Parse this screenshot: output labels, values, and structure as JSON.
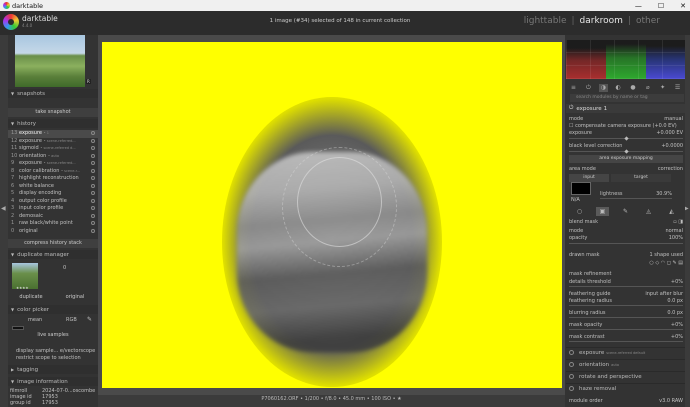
{
  "window": {
    "title": "darktable",
    "controls": [
      "—",
      "☐",
      "✕"
    ]
  },
  "brand": {
    "name": "darktable",
    "version": "4.4.0"
  },
  "header": {
    "collection_info": "1 image (#34) selected of 148 in current collection",
    "views": [
      {
        "label": "lighttable",
        "active": false
      },
      {
        "label": "darkroom",
        "active": true
      },
      {
        "label": "other",
        "active": false
      }
    ],
    "separator": "|"
  },
  "thumb_badge": "R",
  "left": {
    "snapshots": {
      "title": "snapshots",
      "take_snapshot": "take snapshot"
    },
    "history": {
      "title": "history",
      "items": [
        {
          "num": "13",
          "label": "exposure",
          "sub": "• 1"
        },
        {
          "num": "12",
          "label": "exposure",
          "sub": "• scene-referred..."
        },
        {
          "num": "11",
          "label": "sigmoid",
          "sub": "• scene-referred d..."
        },
        {
          "num": "10",
          "label": "orientation",
          "sub": "• auto"
        },
        {
          "num": "9",
          "label": "exposure",
          "sub": "• scene-referred..."
        },
        {
          "num": "8",
          "label": "color calibration",
          "sub": "• scene-r..."
        },
        {
          "num": "7",
          "label": "highlight reconstruction",
          "sub": ""
        },
        {
          "num": "6",
          "label": "white balance",
          "sub": ""
        },
        {
          "num": "5",
          "label": "display encoding",
          "sub": ""
        },
        {
          "num": "4",
          "label": "output color profile",
          "sub": ""
        },
        {
          "num": "3",
          "label": "input color profile",
          "sub": ""
        },
        {
          "num": "2",
          "label": "demosaic",
          "sub": ""
        },
        {
          "num": "1",
          "label": "raw black/white point",
          "sub": ""
        },
        {
          "num": "0",
          "label": "original",
          "sub": ""
        }
      ],
      "compress": "compress history stack"
    },
    "duplicate_manager": {
      "title": "duplicate manager",
      "version_number": "0",
      "stars": "★★★★",
      "duplicate": "duplicate",
      "original": "original"
    },
    "color_picker": {
      "title": "color picker",
      "mode": "mean",
      "space": "RGB",
      "live_samples": "live samples",
      "display_samples": "display sample... e/vectorscope",
      "restrict": "restrict scope to selection"
    },
    "tagging": {
      "title": "tagging"
    },
    "image_information": {
      "title": "image information",
      "rows": [
        {
          "key": "filmroll",
          "value": "2024-07-0...oscombe"
        },
        {
          "key": "image id",
          "value": "17953"
        },
        {
          "key": "group id",
          "value": "17953"
        }
      ]
    }
  },
  "center": {
    "info": "P7060162.ORF • 1/200 • f/8.0 • 45.0 mm • 100 ISO • ★"
  },
  "right": {
    "search_placeholder": "search modules by name or tag",
    "exposure_module": {
      "title": "exposure",
      "instance": "1",
      "mode_label": "mode",
      "mode_value": "manual",
      "compensate": "compensate camera exposure (+0.0 EV)",
      "exposure_label": "exposure",
      "exposure_value": "+0.000 EV",
      "exposure_fraction": 0.5,
      "black_label": "black level correction",
      "black_value": "+0.0000",
      "black_fraction": 0.5,
      "area_mapping": "area exposure mapping",
      "area_mode_label": "area mode",
      "area_mode_value": "correction",
      "input_label": "input",
      "target_label": "target",
      "lightness_label": "lightness",
      "lightness_value": "30.9%",
      "lightness_fraction": 0.309,
      "na": "N/A"
    },
    "blend": {
      "blend_mask": "blend mask",
      "mode_label": "mode",
      "mode_value": "normal",
      "opacity_label": "opacity",
      "opacity_value": "100%",
      "drawn_mask_label": "drawn mask",
      "drawn_mask_value": "1 shape used",
      "mask_refinement": "mask refinement",
      "details_label": "details threshold",
      "details_value": "+0%",
      "feather_guide_label": "feathering guide",
      "feather_guide_value": "input after blur",
      "feather_radius_label": "feathering radius",
      "feather_radius_value": "0.0 px",
      "blur_label": "blurring radius",
      "blur_value": "0.0 px",
      "mask_opacity_label": "mask opacity",
      "mask_opacity_value": "+0%",
      "mask_contrast_label": "mask contrast",
      "mask_contrast_value": "+0%"
    },
    "modules": [
      {
        "label": "exposure",
        "sub": "scene-referred default"
      },
      {
        "label": "orientation",
        "sub": "auto"
      },
      {
        "label": "rotate and perspective",
        "sub": ""
      },
      {
        "label": "haze removal",
        "sub": ""
      }
    ],
    "module_order_label": "module order",
    "module_order_value": "v3.0 RAW"
  }
}
